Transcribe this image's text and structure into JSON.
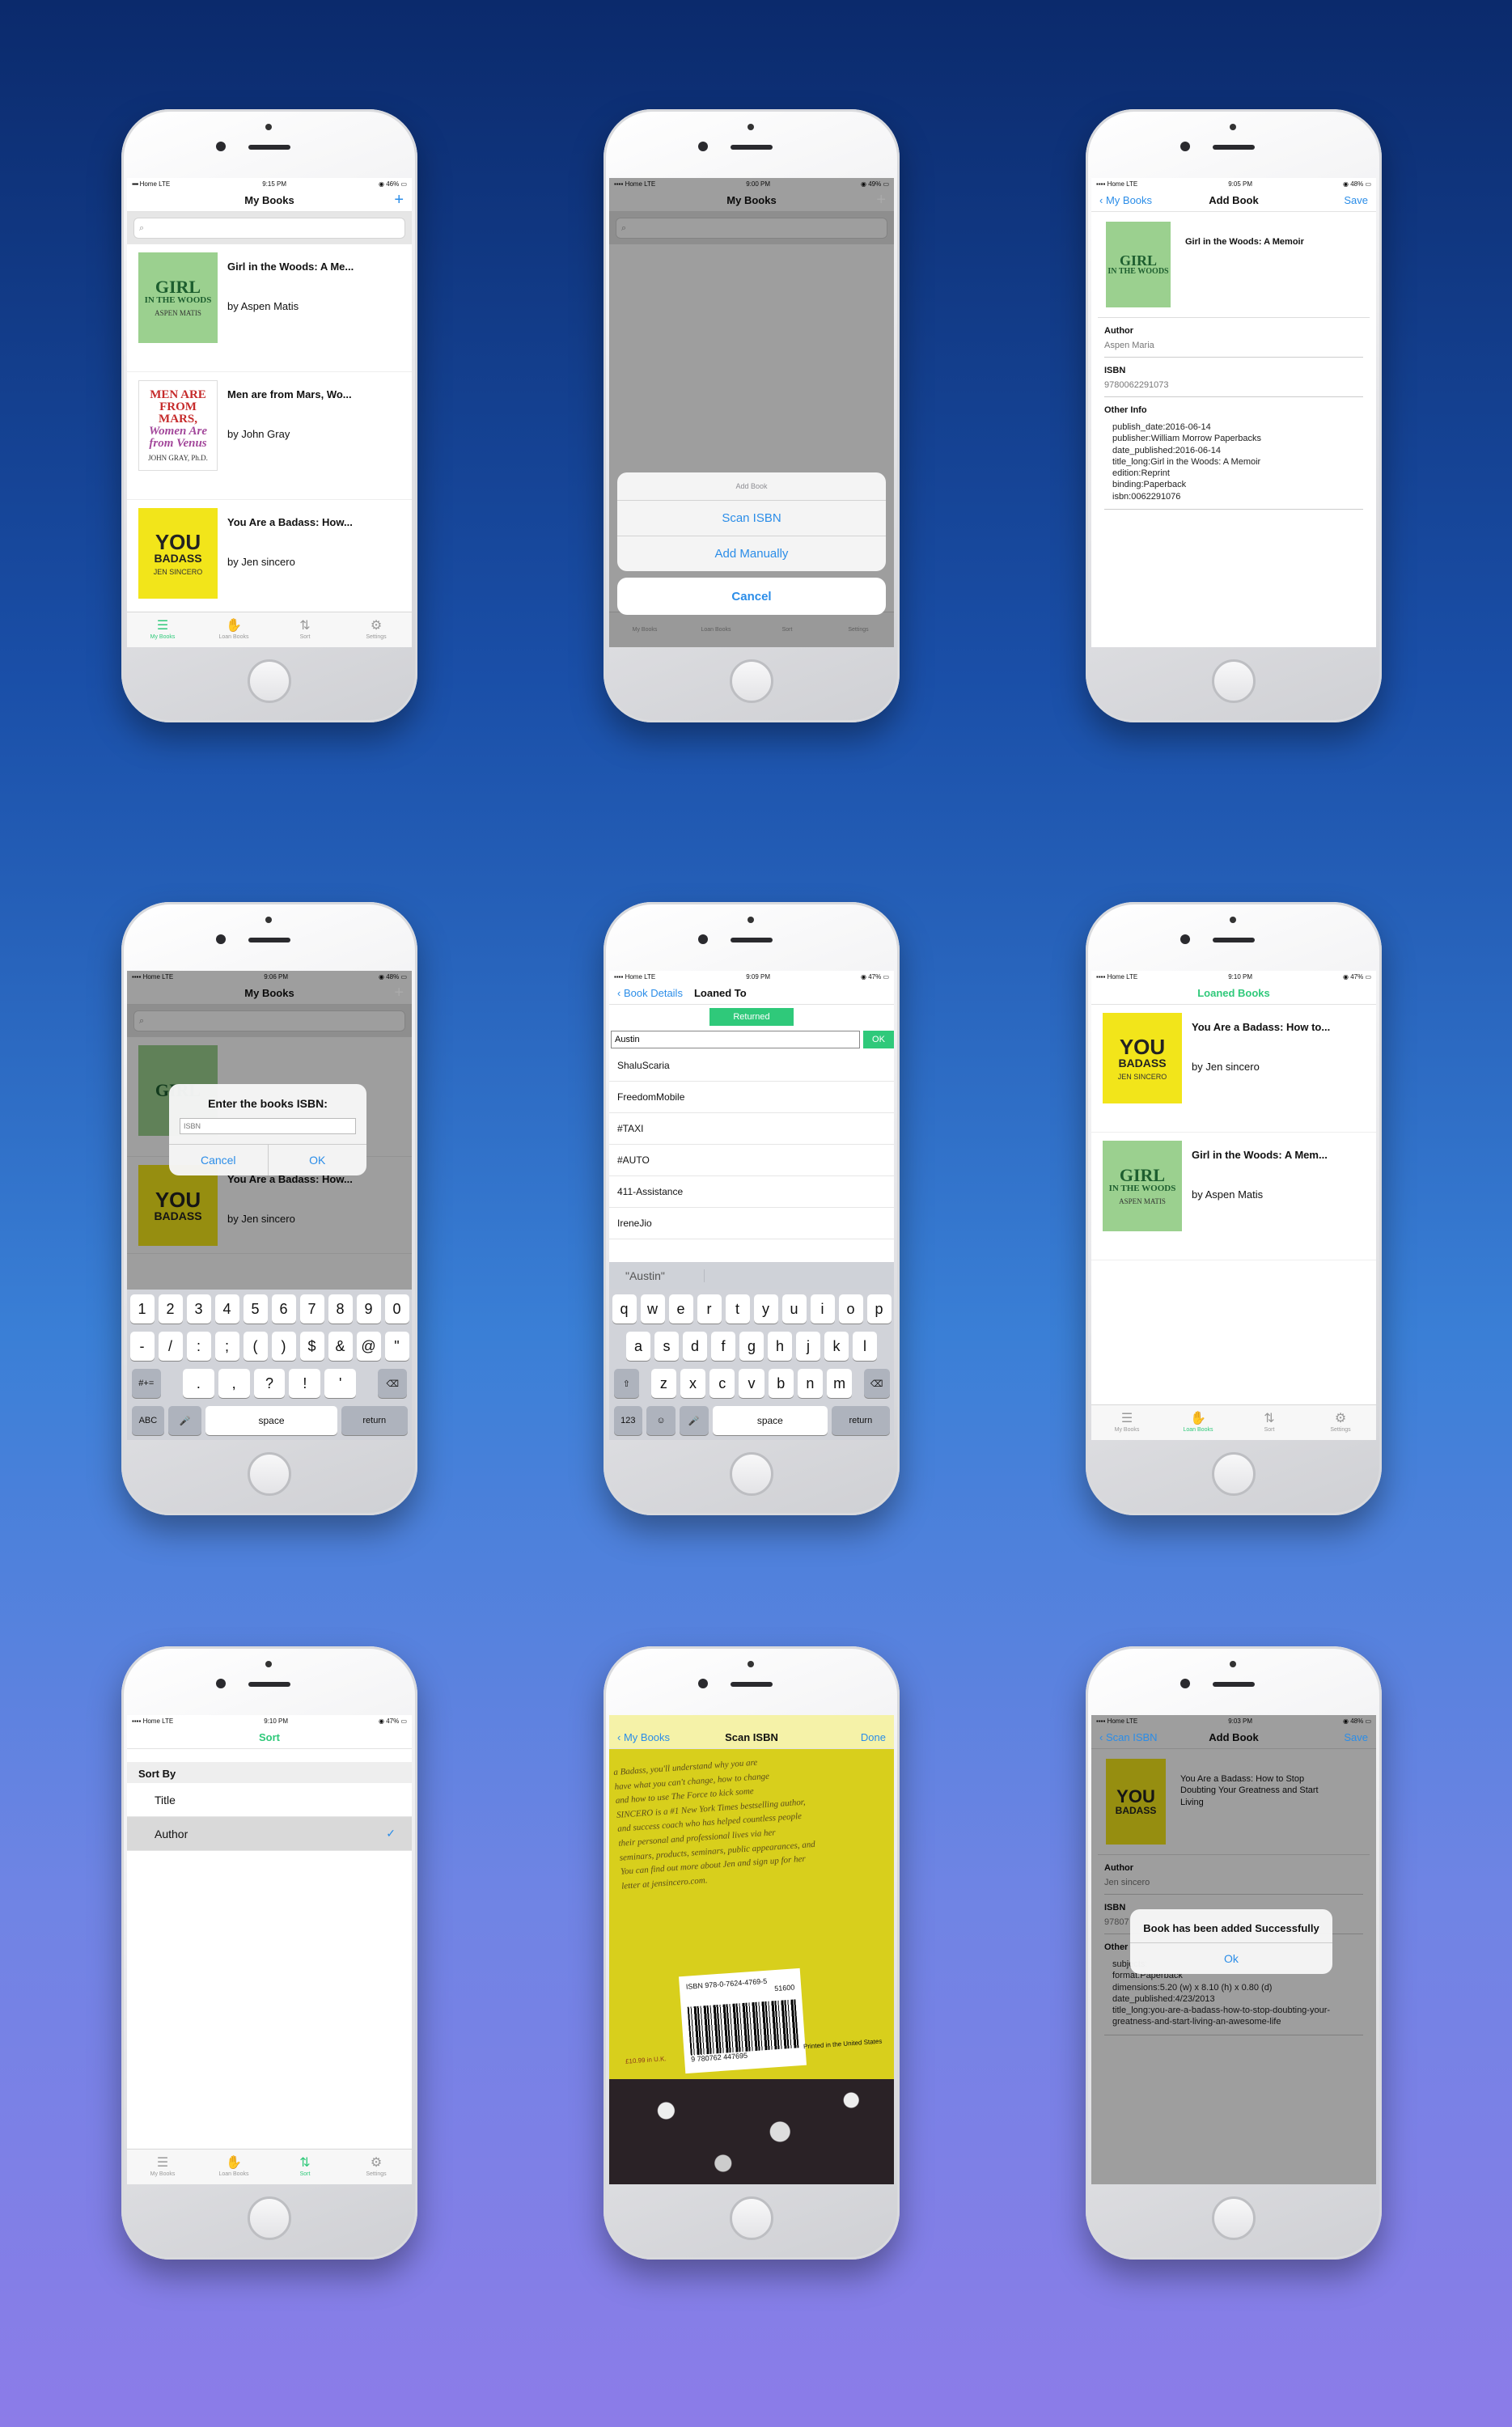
{
  "status_carrier": "Home",
  "status_network": "LTE",
  "tabs": [
    "My Books",
    "Loan Books",
    "Sort",
    "Settings"
  ],
  "s1": {
    "time": "9:15 PM",
    "battery": "46%",
    "title": "My Books",
    "add": "+",
    "books": [
      {
        "title": "Girl in the Woods: A Me...",
        "author": "by Aspen Matis",
        "cover_line1": "GIRL",
        "cover_line2": "IN THE WOODS",
        "cover_sub": "ASPEN MATIS"
      },
      {
        "title": "Men are from Mars, Wo...",
        "author": "by John Gray",
        "cover_line1": "MEN ARE FROM MARS,",
        "cover_line2": "Women Are from Venus",
        "cover_sub": "JOHN GRAY, Ph.D."
      },
      {
        "title": "You Are a Badass: How...",
        "author": "by Jen sincero",
        "cover_line1": "YOU",
        "cover_line2": "BADASS",
        "cover_sub": "JEN SINCERO"
      }
    ]
  },
  "s2": {
    "time": "9:00 PM",
    "battery": "49%",
    "title": "My Books",
    "sheet_title": "Add Book",
    "scan": "Scan ISBN",
    "manual": "Add Manually",
    "cancel": "Cancel"
  },
  "s3": {
    "time": "9:05 PM",
    "battery": "48%",
    "back": "My Books",
    "title": "Add Book",
    "save": "Save",
    "book_title": "Girl in the Woods: A Memoir",
    "author_label": "Author",
    "author": "Aspen Maria",
    "isbn_label": "ISBN",
    "isbn": "9780062291073",
    "other_label": "Other Info",
    "other": "publish_date:2016-06-14\npublisher:William Morrow Paperbacks\ndate_published:2016-06-14\ntitle_long:Girl in the Woods: A Memoir\nedition:Reprint\nbinding:Paperback\nisbn:0062291076"
  },
  "s4": {
    "time": "9:06 PM",
    "battery": "48%",
    "title": "My Books",
    "alert_title": "Enter the books ISBN:",
    "placeholder": "ISBN",
    "cancel": "Cancel",
    "ok": "OK",
    "book_title": "You Are a Badass: How...",
    "book_author": "by Jen sincero",
    "keys_row1": [
      "1",
      "2",
      "3",
      "4",
      "5",
      "6",
      "7",
      "8",
      "9",
      "0"
    ],
    "keys_row2": [
      "-",
      "/",
      ":",
      ";",
      "(",
      ")",
      "$",
      "&",
      "@",
      "\""
    ],
    "keys_row3": [
      ".",
      ",",
      "?",
      "!",
      "'"
    ],
    "key_more": "#+=",
    "key_abc": "ABC",
    "key_space": "space",
    "key_return": "return"
  },
  "s5": {
    "time": "9:09 PM",
    "battery": "47%",
    "back": "Book Details",
    "title": "Loaned To",
    "returned": "Returned",
    "input": "Austin",
    "ok": "OK",
    "contacts": [
      "ShaluScaria",
      "FreedomMobile",
      "#TAXI",
      "#AUTO",
      "411-Assistance",
      "IreneJio"
    ],
    "suggestion": "\"Austin\"",
    "keys_row1": [
      "q",
      "w",
      "e",
      "r",
      "t",
      "y",
      "u",
      "i",
      "o",
      "p"
    ],
    "keys_row2": [
      "a",
      "s",
      "d",
      "f",
      "g",
      "h",
      "j",
      "k",
      "l"
    ],
    "keys_row3": [
      "z",
      "x",
      "c",
      "v",
      "b",
      "n",
      "m"
    ],
    "key_123": "123",
    "key_space": "space",
    "key_return": "return"
  },
  "s6": {
    "time": "9:10 PM",
    "battery": "47%",
    "title": "Loaned Books",
    "books": [
      {
        "title": "You Are a Badass: How to...",
        "author": "by Jen sincero"
      },
      {
        "title": "Girl in the Woods: A Mem...",
        "author": "by Aspen Matis"
      }
    ]
  },
  "s7": {
    "time": "9:10 PM",
    "battery": "47%",
    "title": "Sort",
    "section": "Sort By",
    "options": [
      "Title",
      "Author"
    ],
    "check": "✓"
  },
  "s8": {
    "back": "My Books",
    "title": "Scan ISBN",
    "done": "Done",
    "page_text": "a Badass, you'll understand why you are\nhave what you can't change, how to change\nand how to use The Force to kick some\nSINCERO is a #1 New York Times bestselling author,\nand success coach who has helped countless people\ntheir personal and professional lives via her\nseminars, products, seminars, public appearances, and\nYou can find out more about Jen and sign up for her\nletter at jensincero.com.",
    "isbn_text": "ISBN 978-0-7624-4769-5",
    "barcode_number": "9 780762 447695",
    "price_code": "51600",
    "printed": "Printed in the United States",
    "price": "£10.99 in U.K."
  },
  "s9": {
    "time": "9:03 PM",
    "battery": "48%",
    "back": "Scan ISBN",
    "title": "Add Book",
    "save": "Save",
    "book_title": "You Are a Badass: How to Stop Doubting Your Greatness and Start Living",
    "author_label": "Author",
    "author": "Jen sincero",
    "isbn_label": "ISBN",
    "isbn": "97807",
    "other_label": "Other",
    "other": "subjects:\nformat:Paperback\ndimensions:5.20 (w) x 8.10 (h) x 0.80 (d)\ndate_published:4/23/2013\ntitle_long:you-are-a-badass-how-to-stop-doubting-your-greatness-and-start-living-an-awesome-life",
    "alert_title": "Book has been added Successfully",
    "ok": "Ok"
  }
}
